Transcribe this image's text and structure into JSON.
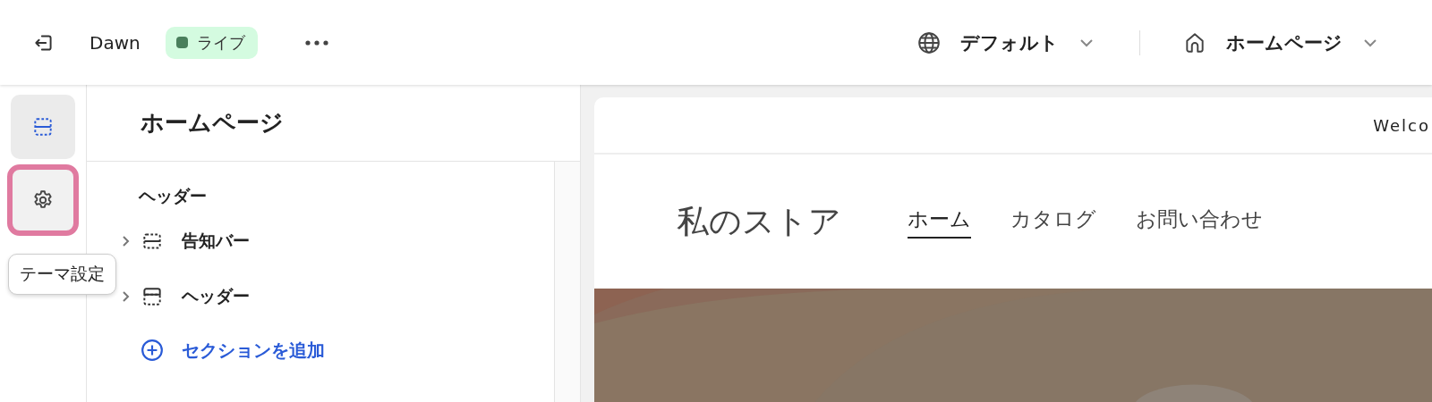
{
  "topbar": {
    "theme_name": "Dawn",
    "status": {
      "label": "ライブ",
      "color": "#4a7f5c"
    },
    "language": "デフォルト",
    "page": "ホームページ"
  },
  "rail": [
    {
      "kind": "sections",
      "selected": true,
      "highlighted": false
    },
    {
      "kind": "settings",
      "selected": false,
      "highlighted": true
    }
  ],
  "tooltip": "テーマ設定",
  "panel": {
    "title": "ホームページ",
    "group": "ヘッダー",
    "items": [
      {
        "kind": "bar",
        "label": "告知バー",
        "expanded": false
      },
      {
        "kind": "header",
        "label": "ヘッダー",
        "expanded": false
      }
    ],
    "add_label": "セクションを追加"
  },
  "preview": {
    "announcement": "Welco",
    "store_name": "私のストア",
    "nav": [
      {
        "label": "ホーム",
        "selected": true
      },
      {
        "label": "カタログ",
        "selected": false
      },
      {
        "label": "お問い合わせ",
        "selected": false
      }
    ]
  }
}
